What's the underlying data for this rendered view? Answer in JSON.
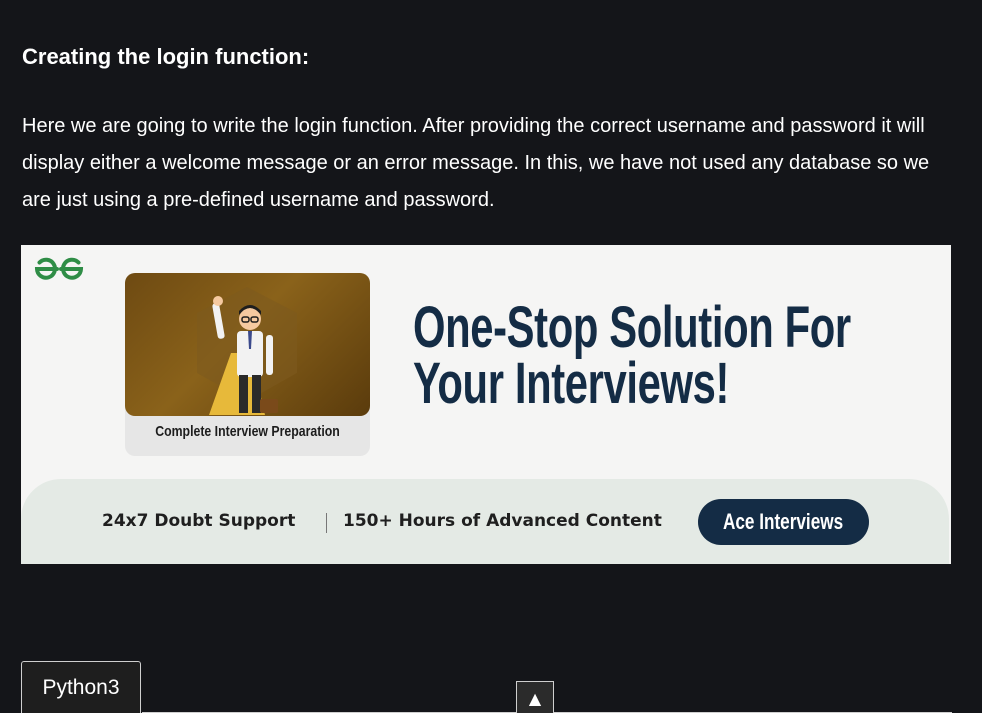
{
  "article": {
    "heading": "Creating the login function:",
    "paragraph": "Here we are going to write the login function. After providing the correct username and password it will display either a welcome message or an error message. In this, we have not used any database so we are just using a pre-defined username and password."
  },
  "banner": {
    "logo_icon": "gfg-logo-icon",
    "card_caption": "Complete Interview Preparation",
    "headline_line1": "One-Stop Solution For",
    "headline_line2": "Your Interviews!",
    "feature1": "24x7 Doubt Support",
    "feature2": "150+ Hours of Advanced Content",
    "cta_label": "Ace Interviews",
    "colors": {
      "headline": "#142c45",
      "logo": "#2f8d46",
      "cta_bg": "#142c45"
    }
  },
  "code_block": {
    "tab_label": "Python3"
  },
  "scroll_top": {
    "icon": "▲"
  }
}
